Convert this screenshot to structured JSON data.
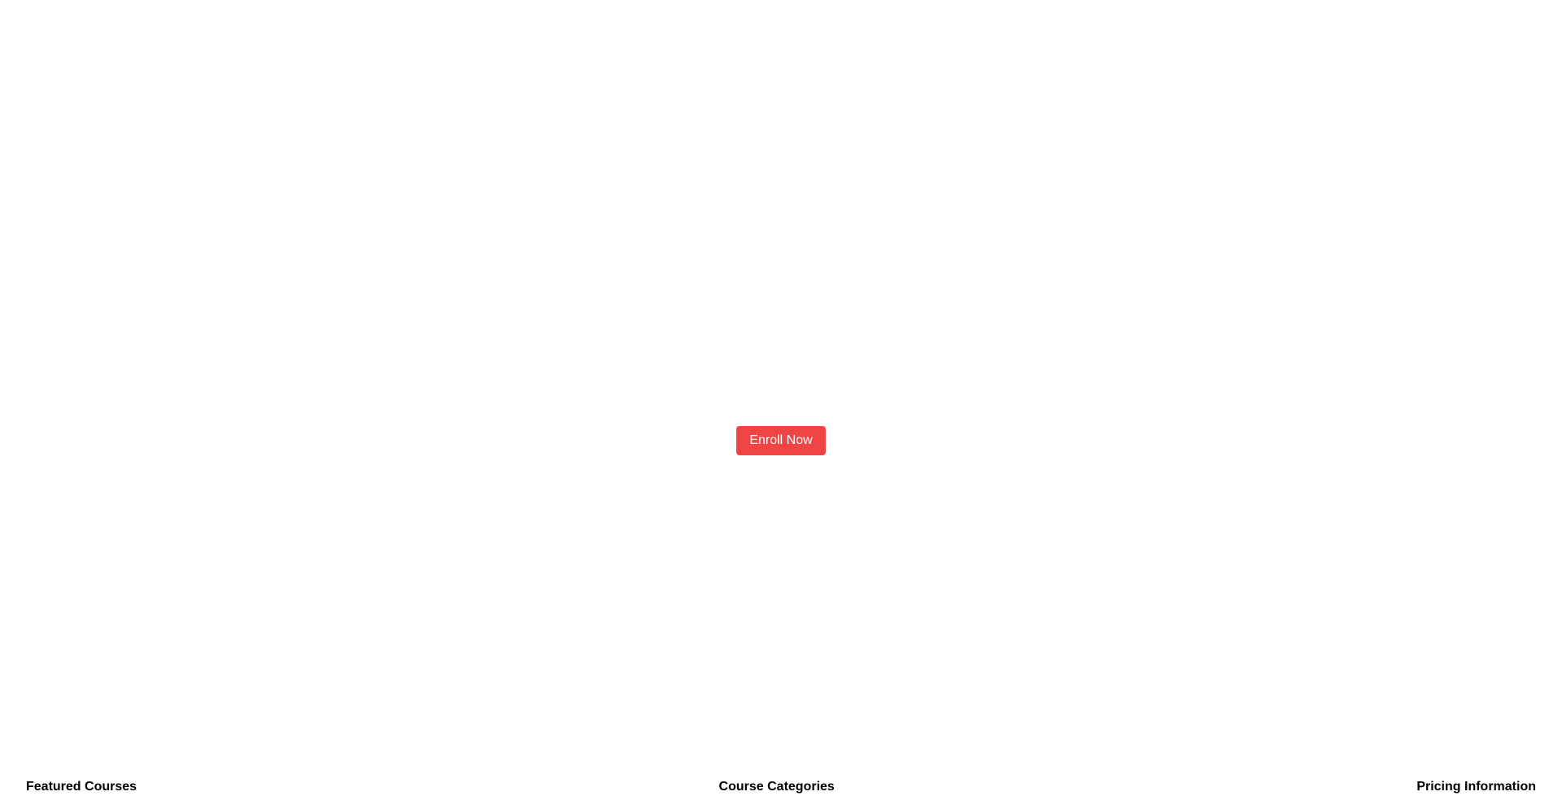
{
  "hero": {
    "cta_label": "Enroll Now",
    "cta_color": "#ef4444",
    "cta_text_color": "#ffffff"
  },
  "footer": {
    "sections": [
      {
        "title": "Featured Courses"
      },
      {
        "title": "Course Categories"
      },
      {
        "title": "Pricing Information"
      }
    ]
  }
}
